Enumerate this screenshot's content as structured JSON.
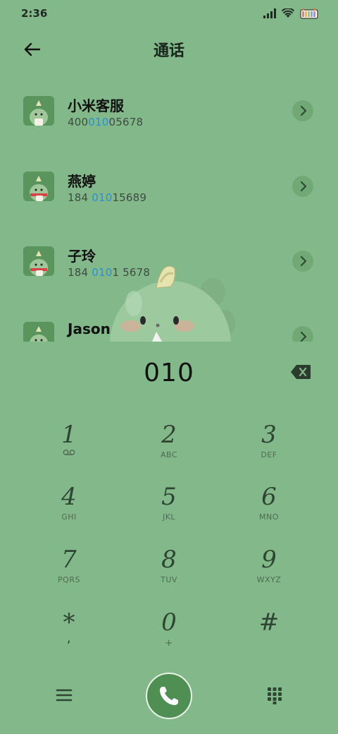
{
  "status_bar": {
    "time": "2:36"
  },
  "header": {
    "title": "通话"
  },
  "contacts": [
    {
      "name": "小米客服",
      "number_pre": "400",
      "number_hl": "010",
      "number_post": "05678"
    },
    {
      "name": "燕婷",
      "number_pre": "184 ",
      "number_hl": "010",
      "number_post": "15689"
    },
    {
      "name": "子玲",
      "number_pre": "184 ",
      "number_hl": "010",
      "number_post": "1 5678"
    },
    {
      "name": "Jason",
      "number_pre": "",
      "number_hl": "",
      "number_post": ""
    }
  ],
  "dialer": {
    "digits": "010",
    "keys": [
      {
        "digit": "1",
        "letters": ""
      },
      {
        "digit": "2",
        "letters": "ABC"
      },
      {
        "digit": "3",
        "letters": "DEF"
      },
      {
        "digit": "4",
        "letters": "GHI"
      },
      {
        "digit": "5",
        "letters": "JKL"
      },
      {
        "digit": "6",
        "letters": "MNO"
      },
      {
        "digit": "7",
        "letters": "PQRS"
      },
      {
        "digit": "8",
        "letters": "TUV"
      },
      {
        "digit": "9",
        "letters": "WXYZ"
      },
      {
        "digit": "*",
        "letters": ","
      },
      {
        "digit": "0",
        "letters": "+"
      },
      {
        "digit": "#",
        "letters": ""
      }
    ]
  },
  "icons": {
    "back": "back-arrow-icon",
    "chevron": "chevron-right-icon",
    "backspace": "backspace-icon",
    "menu": "menu-icon",
    "call": "phone-icon",
    "keypad": "keypad-icon",
    "voicemail": "voicemail-icon"
  },
  "colors": {
    "background": "#83b98a",
    "highlight": "#2a8fd6",
    "call_button": "#4f8f54"
  }
}
